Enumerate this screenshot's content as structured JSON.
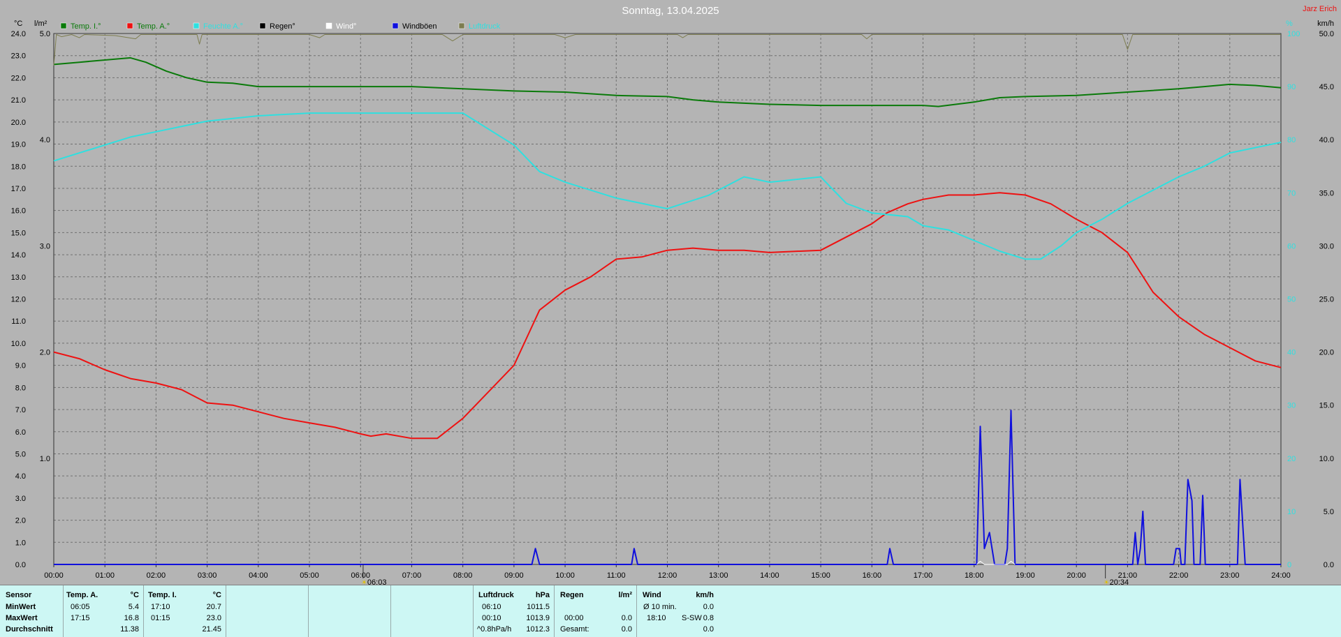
{
  "title": "Sonntag, 13.04.2025",
  "station": "Jarz Erich",
  "colors": {
    "background": "#b4b4b4",
    "temp_in": "#0a7a0a",
    "temp_out": "#ee1111",
    "humidity": "#2ee0e0",
    "rain": "#000000",
    "wind": "#ffffff",
    "gusts": "#1010dd",
    "extra": "#7d7d50",
    "station": "#ee1111",
    "sun_marker": "#e0c000"
  },
  "chart_data": {
    "type": "line",
    "title": "Sonntag, 13.04.2025",
    "x_ticks": [
      "00:00",
      "01:00",
      "02:00",
      "03:00",
      "04:00",
      "05:00",
      "06:00",
      "07:00",
      "08:00",
      "09:00",
      "10:00",
      "11:00",
      "12:00",
      "13:00",
      "14:00",
      "15:00",
      "16:00",
      "17:00",
      "18:00",
      "19:00",
      "20:00",
      "21:00",
      "22:00",
      "23:00",
      "24:00"
    ],
    "xlim": [
      0,
      24
    ],
    "grid": true,
    "legend_position": "top-left",
    "axes": {
      "temp": {
        "unit": "°C",
        "ylim": [
          0,
          24
        ],
        "ticks": [
          "0.0",
          "1.0",
          "2.0",
          "3.0",
          "4.0",
          "5.0",
          "6.0",
          "7.0",
          "8.0",
          "9.0",
          "10.0",
          "11.0",
          "12.0",
          "13.0",
          "14.0",
          "15.0",
          "16.0",
          "17.0",
          "18.0",
          "19.0",
          "20.0",
          "21.0",
          "22.0",
          "23.0",
          "24.0"
        ]
      },
      "rain": {
        "unit": "l/m²",
        "ylim": [
          0,
          5
        ],
        "ticks": [
          "1.0",
          "2.0",
          "3.0",
          "4.0",
          "5.0"
        ]
      },
      "humidity": {
        "unit": "%",
        "ylim": [
          0,
          100
        ],
        "ticks": [
          "0",
          "10",
          "20",
          "30",
          "40",
          "50",
          "60",
          "70",
          "80",
          "90",
          "100"
        ]
      },
      "wind": {
        "unit": "km/h",
        "ylim": [
          0,
          50
        ],
        "ticks": [
          "0.0",
          "5.0",
          "10.0",
          "15.0",
          "20.0",
          "25.0",
          "30.0",
          "35.0",
          "40.0",
          "45.0",
          "50.0"
        ]
      }
    },
    "legend": [
      "Temp. I.°",
      "Temp. A.°",
      "Feuchte A.°",
      "Regen°",
      "Wind°",
      "Windböen",
      "Luftdruck"
    ],
    "sun_markers": [
      "06:03",
      "20:34"
    ],
    "series": [
      {
        "name": "Temp. I.°",
        "axis": "temp",
        "color": "#0a7a0a",
        "points": [
          [
            0,
            22.6
          ],
          [
            0.5,
            22.7
          ],
          [
            1,
            22.8
          ],
          [
            1.5,
            22.9
          ],
          [
            1.8,
            22.7
          ],
          [
            2.2,
            22.3
          ],
          [
            2.6,
            22.0
          ],
          [
            3,
            21.8
          ],
          [
            3.5,
            21.75
          ],
          [
            4,
            21.6
          ],
          [
            5,
            21.6
          ],
          [
            6,
            21.6
          ],
          [
            7,
            21.6
          ],
          [
            8,
            21.5
          ],
          [
            9,
            21.4
          ],
          [
            10,
            21.35
          ],
          [
            11,
            21.2
          ],
          [
            12,
            21.15
          ],
          [
            12.5,
            21.0
          ],
          [
            13,
            20.9
          ],
          [
            14,
            20.8
          ],
          [
            15,
            20.75
          ],
          [
            16,
            20.75
          ],
          [
            17,
            20.75
          ],
          [
            17.3,
            20.7
          ],
          [
            18,
            20.9
          ],
          [
            18.5,
            21.1
          ],
          [
            19,
            21.15
          ],
          [
            20,
            21.2
          ],
          [
            21,
            21.35
          ],
          [
            22,
            21.5
          ],
          [
            22.5,
            21.6
          ],
          [
            23,
            21.7
          ],
          [
            23.5,
            21.65
          ],
          [
            24,
            21.55
          ]
        ]
      },
      {
        "name": "Temp. A.°",
        "axis": "temp",
        "color": "#ee1111",
        "points": [
          [
            0,
            9.6
          ],
          [
            0.5,
            9.3
          ],
          [
            1,
            8.8
          ],
          [
            1.5,
            8.4
          ],
          [
            2,
            8.2
          ],
          [
            2.5,
            7.9
          ],
          [
            3,
            7.3
          ],
          [
            3.5,
            7.2
          ],
          [
            4,
            6.9
          ],
          [
            4.5,
            6.6
          ],
          [
            5,
            6.4
          ],
          [
            5.5,
            6.2
          ],
          [
            6,
            5.9
          ],
          [
            6.2,
            5.8
          ],
          [
            6.5,
            5.9
          ],
          [
            7,
            5.7
          ],
          [
            7.5,
            5.7
          ],
          [
            8,
            6.6
          ],
          [
            8.5,
            7.8
          ],
          [
            9,
            9.0
          ],
          [
            9.5,
            11.5
          ],
          [
            10,
            12.4
          ],
          [
            10.5,
            13.0
          ],
          [
            11,
            13.8
          ],
          [
            11.5,
            13.9
          ],
          [
            12,
            14.2
          ],
          [
            12.5,
            14.3
          ],
          [
            13,
            14.2
          ],
          [
            13.5,
            14.2
          ],
          [
            14,
            14.1
          ],
          [
            15,
            14.2
          ],
          [
            15.5,
            14.8
          ],
          [
            16,
            15.4
          ],
          [
            16.3,
            15.9
          ],
          [
            16.7,
            16.3
          ],
          [
            17,
            16.5
          ],
          [
            17.5,
            16.7
          ],
          [
            18,
            16.7
          ],
          [
            18.5,
            16.8
          ],
          [
            19,
            16.7
          ],
          [
            19.5,
            16.3
          ],
          [
            20,
            15.6
          ],
          [
            20.5,
            15.0
          ],
          [
            21,
            14.1
          ],
          [
            21.5,
            12.3
          ],
          [
            22,
            11.2
          ],
          [
            22.5,
            10.4
          ],
          [
            23,
            9.8
          ],
          [
            23.5,
            9.2
          ],
          [
            24,
            8.9
          ]
        ]
      },
      {
        "name": "Feuchte A.°",
        "axis": "humidity",
        "color": "#2ee0e0",
        "points": [
          [
            0,
            76
          ],
          [
            1,
            79
          ],
          [
            1.5,
            80.5
          ],
          [
            2,
            81.5
          ],
          [
            3,
            83.5
          ],
          [
            4,
            84.5
          ],
          [
            5,
            85
          ],
          [
            6,
            85
          ],
          [
            7,
            85
          ],
          [
            8,
            85
          ],
          [
            9,
            79
          ],
          [
            9.5,
            74
          ],
          [
            10,
            72
          ],
          [
            11,
            69
          ],
          [
            12,
            67
          ],
          [
            12.8,
            69.5
          ],
          [
            13.5,
            73
          ],
          [
            14,
            72
          ],
          [
            15,
            73
          ],
          [
            15.5,
            68
          ],
          [
            16,
            66.2
          ],
          [
            16.7,
            65.5
          ],
          [
            17,
            63.8
          ],
          [
            17.5,
            63
          ],
          [
            18,
            61
          ],
          [
            18.5,
            59
          ],
          [
            19,
            57.5
          ],
          [
            19.3,
            57.5
          ],
          [
            19.7,
            60
          ],
          [
            20,
            62.5
          ],
          [
            20.5,
            65
          ],
          [
            21,
            68
          ],
          [
            21.5,
            70.5
          ],
          [
            22,
            73
          ],
          [
            22.5,
            75
          ],
          [
            23,
            77.5
          ],
          [
            24,
            79.5
          ]
        ]
      },
      {
        "name": "Windböen",
        "axis": "wind",
        "color": "#1010dd",
        "points": [
          [
            0,
            0
          ],
          [
            9.35,
            0
          ],
          [
            9.42,
            1.5
          ],
          [
            9.5,
            0
          ],
          [
            11.3,
            0
          ],
          [
            11.35,
            1.5
          ],
          [
            11.42,
            0
          ],
          [
            16.3,
            0
          ],
          [
            16.35,
            1.5
          ],
          [
            16.42,
            0
          ],
          [
            18.05,
            0
          ],
          [
            18.12,
            13
          ],
          [
            18.2,
            1.5
          ],
          [
            18.3,
            3.0
          ],
          [
            18.4,
            0
          ],
          [
            18.6,
            0
          ],
          [
            18.65,
            1.5
          ],
          [
            18.72,
            14.5
          ],
          [
            18.8,
            0
          ],
          [
            21.1,
            0
          ],
          [
            21.15,
            3.0
          ],
          [
            21.2,
            0
          ],
          [
            21.25,
            1.5
          ],
          [
            21.3,
            5.0
          ],
          [
            21.35,
            0
          ],
          [
            21.9,
            0
          ],
          [
            21.95,
            1.5
          ],
          [
            22.02,
            1.5
          ],
          [
            22.05,
            0
          ],
          [
            22.12,
            0
          ],
          [
            22.18,
            8.0
          ],
          [
            22.26,
            6.0
          ],
          [
            22.3,
            0
          ],
          [
            22.42,
            0
          ],
          [
            22.47,
            6.5
          ],
          [
            22.52,
            0
          ],
          [
            23.15,
            0
          ],
          [
            23.2,
            8.0
          ],
          [
            23.3,
            0
          ],
          [
            24,
            0
          ]
        ]
      },
      {
        "name": "Wind°",
        "axis": "wind",
        "color": "#ffffff",
        "points": [
          [
            18.05,
            0
          ],
          [
            18.12,
            0.3
          ],
          [
            18.2,
            0
          ],
          [
            18.65,
            0
          ],
          [
            18.72,
            0.3
          ],
          [
            18.8,
            0
          ]
        ]
      },
      {
        "name": "Luftdruck",
        "axis": "rain",
        "color": "#7d7d50",
        "points": [
          [
            0,
            4.7
          ],
          [
            0.05,
            4.99
          ],
          [
            0.15,
            4.97
          ],
          [
            0.35,
            4.99
          ],
          [
            0.5,
            4.96
          ],
          [
            0.6,
            4.99
          ],
          [
            1.2,
            4.98
          ],
          [
            1.6,
            4.95
          ],
          [
            1.7,
            4.99
          ],
          [
            2.8,
            4.99
          ],
          [
            2.85,
            4.9
          ],
          [
            2.9,
            4.99
          ],
          [
            5,
            4.99
          ],
          [
            5.2,
            4.96
          ],
          [
            5.3,
            4.99
          ],
          [
            7.6,
            4.99
          ],
          [
            7.8,
            4.93
          ],
          [
            8.0,
            4.99
          ],
          [
            9.8,
            4.99
          ],
          [
            10,
            4.96
          ],
          [
            10.2,
            4.99
          ],
          [
            12.2,
            4.99
          ],
          [
            12.3,
            4.96
          ],
          [
            12.4,
            4.99
          ],
          [
            15.8,
            4.99
          ],
          [
            15.9,
            4.95
          ],
          [
            16,
            4.99
          ],
          [
            20.9,
            4.99
          ],
          [
            21.0,
            4.85
          ],
          [
            21.1,
            4.99
          ],
          [
            24,
            4.99
          ]
        ]
      }
    ]
  },
  "stats": {
    "sensor_label": "Sensor",
    "row_labels": [
      "MinWert",
      "MaxWert",
      "Durchschnitt"
    ],
    "temp_a": {
      "title": "Temp. A.",
      "unit": "°C",
      "min_time": "06:05",
      "min": "5.4",
      "max_time": "17:15",
      "max": "16.8",
      "avg": "11.38"
    },
    "temp_i": {
      "title": "Temp. I.",
      "unit": "°C",
      "min_time": "17:10",
      "min": "20.7",
      "max_time": "01:15",
      "max": "23.0",
      "avg": "21.45"
    },
    "pressure": {
      "title": "Luftdruck",
      "unit": "hPa",
      "min_time": "06:10",
      "min": "1011.5",
      "max_time": "00:10",
      "max": "1013.9",
      "trend_label": "^0.8hPa/h",
      "current": "1012.3"
    },
    "rain": {
      "title": "Regen",
      "unit": "l/m²",
      "r1_time": "00:00",
      "r1": "0.0",
      "total_label": "Gesamt:",
      "total": "0.0"
    },
    "wind": {
      "title": "Wind",
      "unit": "km/h",
      "avg_label": "Ø 10 min.",
      "avg": "0.0",
      "max_time": "18:10",
      "max_dir": "S-SW",
      "max": "0.8",
      "last": "0.0"
    }
  }
}
